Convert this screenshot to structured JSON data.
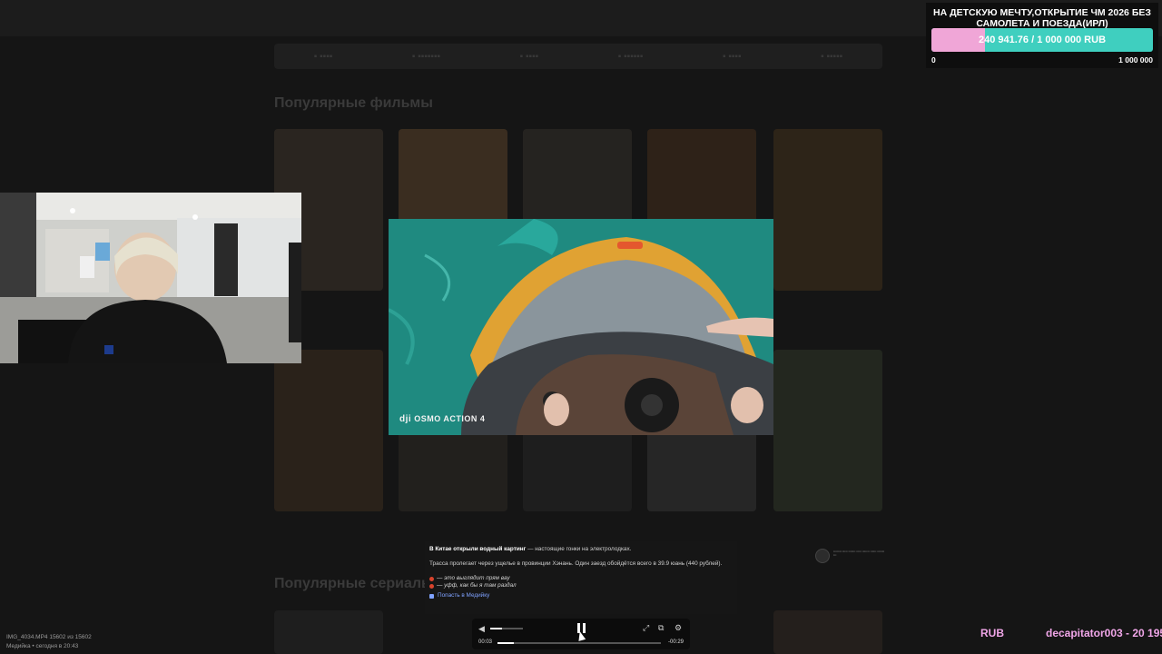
{
  "goal": {
    "title": "НА ДЕТСКУЮ МЕЧТУ,ОТКРЫТИЕ ЧМ 2026 БЕЗ САМОЛЕТА И ПОЕЗДА(ИРЛ)",
    "amount_text": "240 941.76 / 1 000 000 RUB",
    "progress": 0.2409,
    "min_label": "0",
    "max_label": "1 000 000",
    "colors": {
      "fill": "#f0a6d7",
      "track": "#3fcfbf"
    }
  },
  "video": {
    "watermark": "OSMO ACTION 4"
  },
  "post": {
    "headline_bold": "В Китае открыли водный картинг",
    "headline_rest": " — настоящие гонки на электролодках.",
    "body": "Трасса пролегает через ущелье в провинции Хэнань. Один заезд обойдётся всего в 39.9 юань (440 рублей).",
    "quote1": "— это выглядит прям вау",
    "quote2": "— уфф, как бы я там раздал",
    "link": "Попасть в Медийку"
  },
  "player": {
    "time_current": "00:03",
    "time_remaining": "-00:29",
    "seek_progress": 0.1,
    "volume": 0.35
  },
  "file_info": {
    "line1": "IMG_4034.MP4 15602 из 15602",
    "line2": "Медийка • сегодня в 20:43"
  },
  "ticker": {
    "currency": "RUB",
    "donor": "decapitator003 - 20 195"
  },
  "background_site": {
    "section1": "Популярные фильмы",
    "section2": "Популярные сериалы"
  }
}
